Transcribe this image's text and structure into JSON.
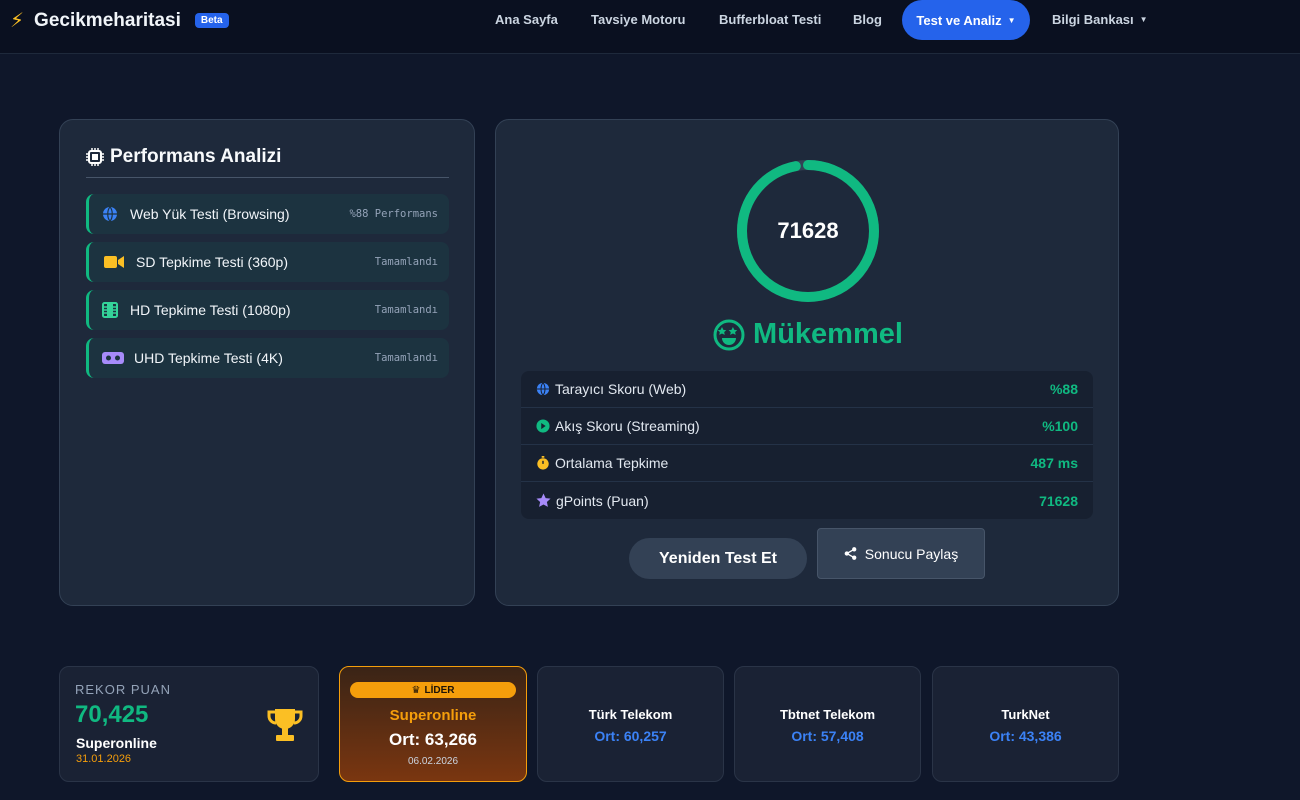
{
  "nav": {
    "brand": "Gecikmeharitasi",
    "beta": "Beta",
    "items": [
      "Ana Sayfa",
      "Tavsiye Motoru",
      "Bufferbloat Testi",
      "Blog"
    ],
    "active": "Test ve Analiz",
    "knowledge": "Bilgi Bankası"
  },
  "performance": {
    "title": "Performans Analizi",
    "tests": [
      {
        "label": "Web Yük Testi (Browsing)",
        "status": "%88 Performans",
        "icon": "globe-icon"
      },
      {
        "label": "SD Tepkime Testi (360p)",
        "status": "Tamamlandı",
        "icon": "video-camera-icon"
      },
      {
        "label": "HD Tepkime Testi (1080p)",
        "status": "Tamamlandı",
        "icon": "film-icon"
      },
      {
        "label": "UHD Tepkime Testi (4K)",
        "status": "Tamamlandı",
        "icon": "vr-headset-icon"
      }
    ]
  },
  "score": {
    "value": "71628",
    "progress": 0.97,
    "verdict": "Mükemmel",
    "stats": [
      {
        "label": "Tarayıcı Skoru (Web)",
        "value": "%88",
        "icon": "globe-icon"
      },
      {
        "label": "Akış Skoru (Streaming)",
        "value": "%100",
        "icon": "play-circle-icon"
      },
      {
        "label": "Ortalama Tepkime",
        "value": "487 ms",
        "icon": "stopwatch-icon"
      },
      {
        "label": "gPoints (Puan)",
        "value": "71628",
        "icon": "star-icon"
      }
    ],
    "retest": "Yeniden Test Et",
    "share": "Sonucu Paylaş"
  },
  "record": {
    "label": "REKOR PUAN",
    "score": "70,425",
    "isp": "Superonline",
    "date": "31.01.2026"
  },
  "leader": {
    "badge": "LİDER",
    "isp": "Superonline",
    "avg": "Ort: 63,266",
    "date": "06.02.2026"
  },
  "isps": [
    {
      "name": "Türk Telekom",
      "avg": "Ort: 60,257"
    },
    {
      "name": "Tbtnet Telekom",
      "avg": "Ort: 57,408"
    },
    {
      "name": "TurkNet",
      "avg": "Ort: 43,386"
    }
  ],
  "colors": {
    "accent": "#10b981",
    "primary": "#2563eb",
    "gold": "#f59e0b"
  }
}
